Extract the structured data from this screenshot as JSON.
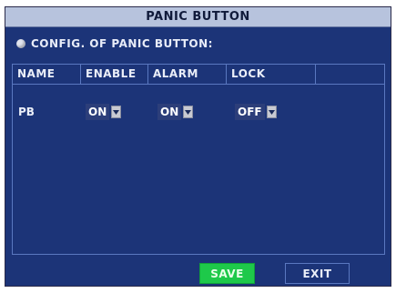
{
  "window": {
    "title": "PANIC BUTTON"
  },
  "section": {
    "label": "CONFIG. OF PANIC BUTTON:"
  },
  "table": {
    "headers": [
      "NAME",
      "ENABLE",
      "ALARM",
      "LOCK",
      ""
    ],
    "rows": [
      {
        "name": "PB",
        "enable": "ON",
        "alarm": "ON",
        "lock": "OFF"
      }
    ]
  },
  "buttons": {
    "save": "SAVE",
    "exit": "EXIT"
  },
  "colors": {
    "background": "#1c3478",
    "titlebar": "#b7c3dd",
    "save_button": "#1ec94a",
    "border": "#5a78c0"
  }
}
